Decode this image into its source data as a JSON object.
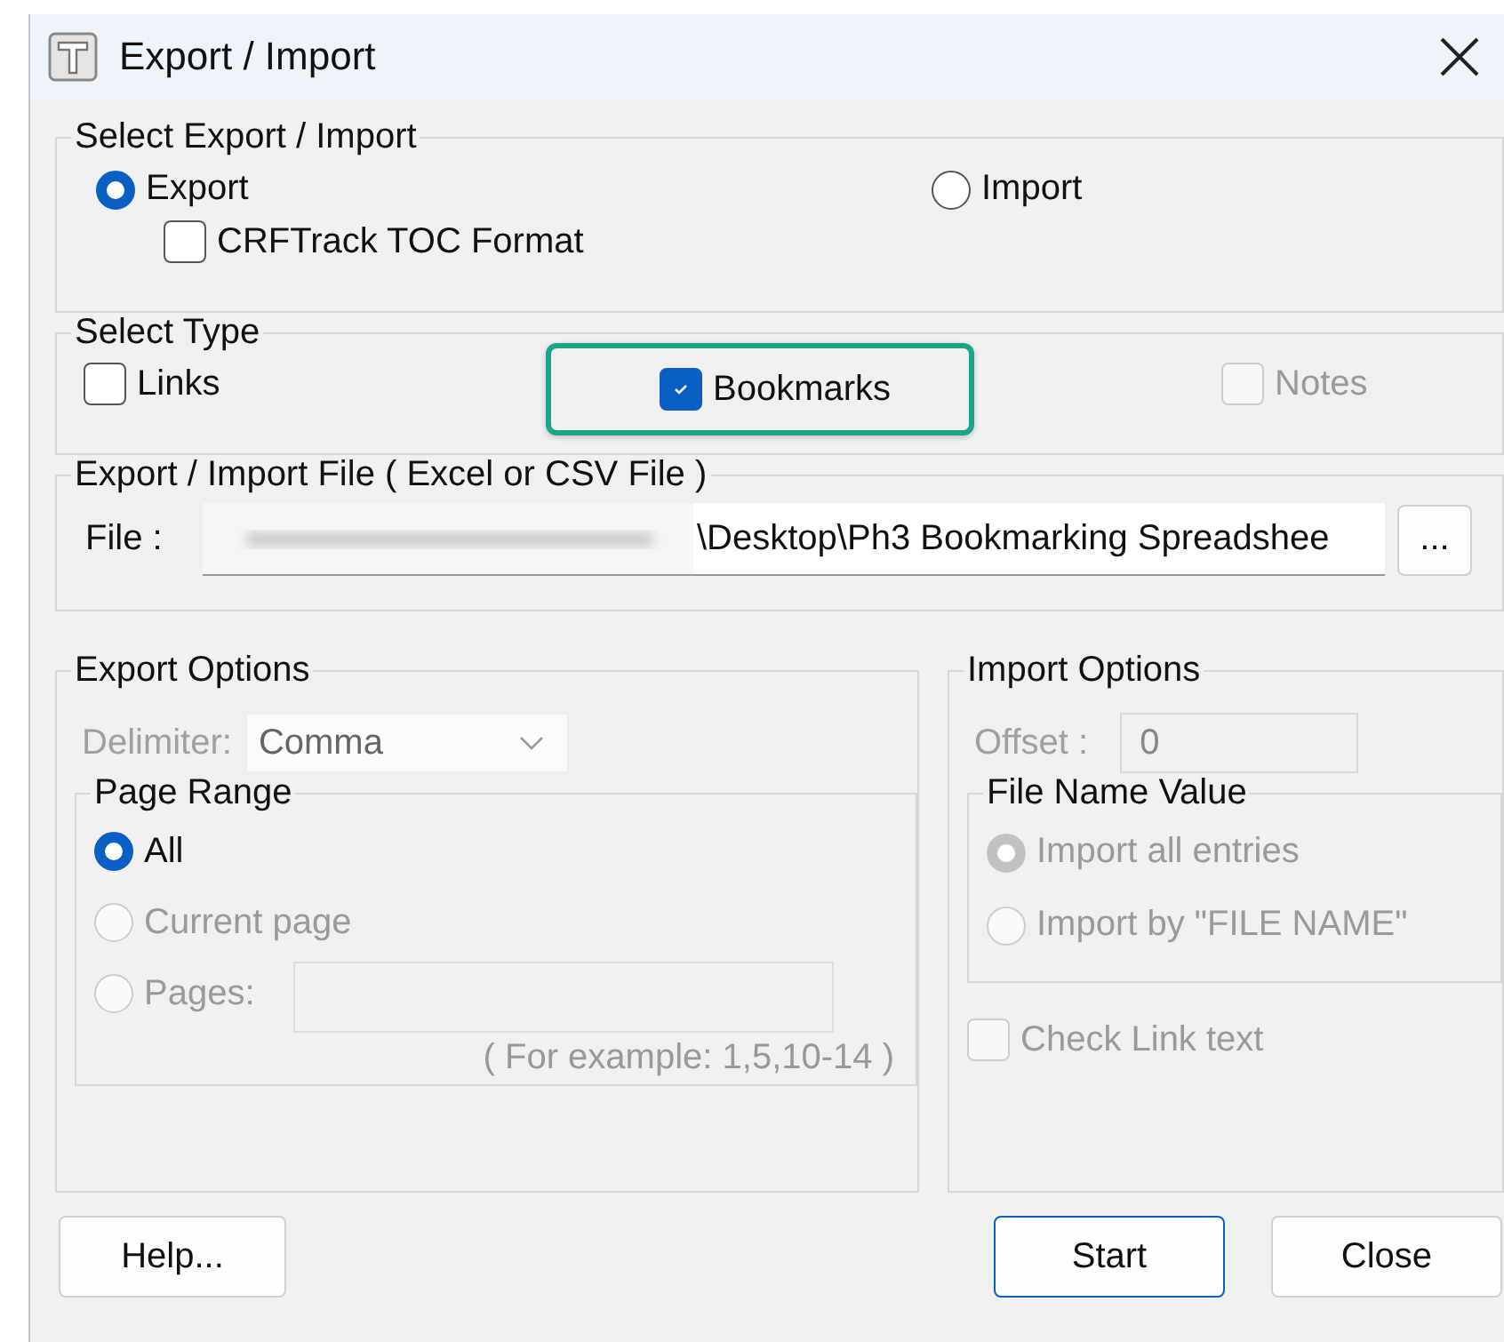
{
  "window": {
    "title": "Export / Import"
  },
  "mode_group": {
    "title": "Select Export / Import",
    "options": [
      {
        "label": "Export",
        "selected": true
      },
      {
        "label": "Import",
        "selected": false
      }
    ],
    "toc_format": {
      "label": "CRFTrack TOC Format",
      "checked": false
    }
  },
  "type_group": {
    "title": "Select Type",
    "options": [
      {
        "label": "Links",
        "checked": false,
        "disabled": false,
        "highlighted": false
      },
      {
        "label": "Bookmarks",
        "checked": true,
        "disabled": false,
        "highlighted": true
      },
      {
        "label": "Notes",
        "checked": false,
        "disabled": true,
        "highlighted": false
      }
    ]
  },
  "file_group": {
    "title": "Export / Import File ( Excel or CSV File )",
    "label": "File :",
    "value": "\\Desktop\\Ph3 Bookmarking Spreadshee",
    "browse_button": "..."
  },
  "export_options": {
    "title": "Export Options",
    "delimiter": {
      "label": "Delimiter:",
      "value": "Comma",
      "disabled": true
    },
    "page_range": {
      "title": "Page Range",
      "options": [
        {
          "label": "All",
          "selected": true,
          "disabled": false
        },
        {
          "label": "Current page",
          "selected": false,
          "disabled": true
        },
        {
          "label": "Pages:",
          "selected": false,
          "disabled": true
        }
      ],
      "hint": "( For example: 1,5,10-14 )"
    }
  },
  "import_options": {
    "title": "Import Options",
    "offset": {
      "label": "Offset :",
      "value": "0",
      "disabled": true
    },
    "file_name_value": {
      "title": "File Name Value",
      "options": [
        {
          "label": "Import all entries",
          "selected": true,
          "disabled": true
        },
        {
          "label": "Import by \"FILE NAME\"",
          "selected": false,
          "disabled": true
        }
      ]
    },
    "check_link_text": {
      "label": "Check Link text",
      "checked": false,
      "disabled": true
    }
  },
  "buttons": [
    {
      "label": "Help...",
      "default": false
    },
    {
      "label": "Start",
      "default": true
    },
    {
      "label": "Close",
      "default": false
    }
  ]
}
